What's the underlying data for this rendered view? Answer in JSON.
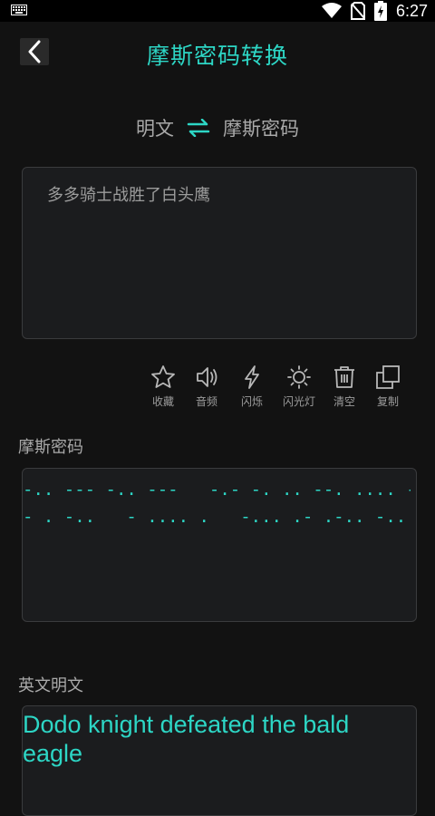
{
  "status_bar": {
    "time": "6:27"
  },
  "header": {
    "back_label": "<",
    "title": "摩斯密码转换"
  },
  "mode_switch": {
    "left": "明文",
    "right": "摩斯密码"
  },
  "input": {
    "value": "多多骑士战胜了白头鹰"
  },
  "tools": [
    {
      "label": "收藏",
      "icon": "star-icon"
    },
    {
      "label": "音频",
      "icon": "speaker-icon"
    },
    {
      "label": "闪烁",
      "icon": "flash-icon"
    },
    {
      "label": "闪光灯",
      "icon": "sun-icon"
    },
    {
      "label": "清空",
      "icon": "trash-icon"
    },
    {
      "label": "复制",
      "icon": "copy-icon"
    }
  ],
  "morse_section": {
    "label": "摩斯密码",
    "lines": [
      "-.. --- -.. ---   -.- -. .. --. .... -   -.. . ..-. . .-",
      "- . -..   - .... .   -... .- .-.. -..   . .- --. .-.. ."
    ]
  },
  "english_section": {
    "label": "英文明文",
    "text": "Dodo knight defeated the bald eagle"
  },
  "colors": {
    "accent": "#2dd6c5",
    "background": "#121212",
    "box": "#1b1c1e"
  }
}
